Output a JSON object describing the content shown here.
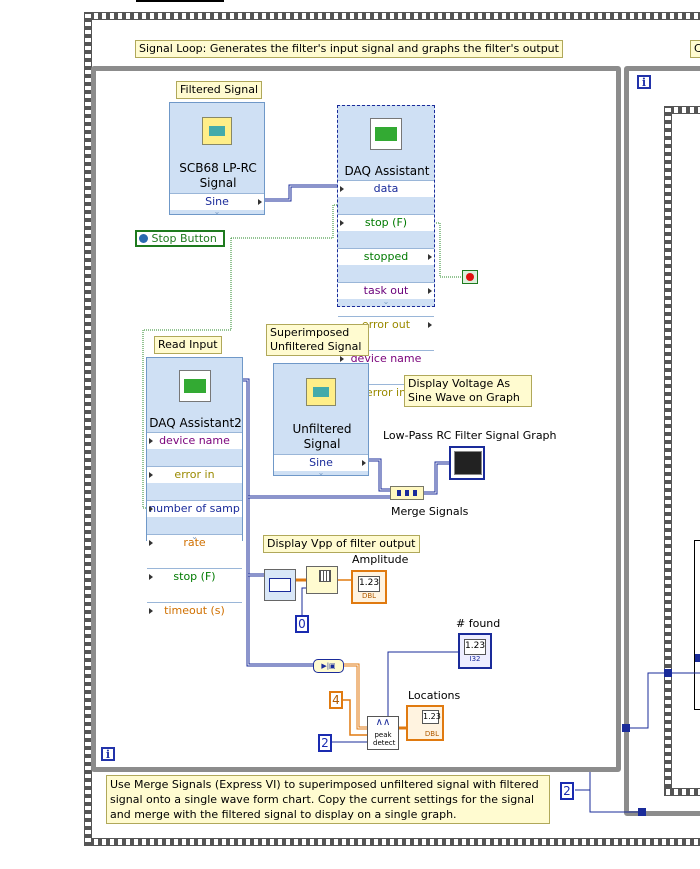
{
  "outer_loop": {
    "note": "Signal Loop: Generates the filter's input signal and graphs the filter's output",
    "right_note_fragment": "C"
  },
  "inner_loop": {
    "info_icon": "i",
    "bottom_note": "Use Merge Signals (Express VI) to superimposed unfiltered signal with filtered signal onto a single wave form chart. Copy the current settings for the signal and merge with the filtered signal to display on a single graph.",
    "count_constant": "2"
  },
  "right_loop": {
    "info_icon": "i"
  },
  "filtered_signal": {
    "label": "Filtered Signal",
    "title": "SCB68 LP-RC Signal",
    "terminal": "Sine"
  },
  "daq_assistant": {
    "title": "DAQ Assistant",
    "terminals": [
      {
        "label": "data",
        "color": "#1a2b9a"
      },
      {
        "label": "stop (F)",
        "color": "#007a00"
      },
      {
        "label": "stopped",
        "color": "#007a00"
      },
      {
        "label": "task out",
        "color": "#6a007a"
      },
      {
        "label": "error out",
        "color": "#9a8a00"
      },
      {
        "label": "device name",
        "color": "#7a007a"
      },
      {
        "label": "error in",
        "color": "#9a8a00"
      }
    ]
  },
  "stop_button": {
    "label": "Stop Button"
  },
  "read_input": {
    "label": "Read Input",
    "title": "DAQ Assistant2",
    "terminals": [
      {
        "label": "device name",
        "color": "#7a007a"
      },
      {
        "label": "error in",
        "color": "#9a8a00"
      },
      {
        "label": "number of samp",
        "color": "#1a2b9a"
      },
      {
        "label": "rate",
        "color": "#d07000"
      },
      {
        "label": "stop (F)",
        "color": "#007a00"
      },
      {
        "label": "timeout (s)",
        "color": "#d07000"
      }
    ]
  },
  "unfiltered_signal": {
    "label": "Superimposed Unfiltered Signal",
    "title": "Unfiltered Signal",
    "terminal": "Sine"
  },
  "display_voltage_note": "Display Voltage As Sine Wave on Graph",
  "graph": {
    "label": "Low-Pass RC Filter Signal Graph"
  },
  "merge_signals": {
    "label": "Merge Signals"
  },
  "vpp_note": "Display Vpp of filter output",
  "amplitude": {
    "label": "Amplitude",
    "display": "1.23",
    "type": "DBL"
  },
  "index_constant": "0",
  "found": {
    "label": "# found",
    "display": "1.23",
    "type": "I32"
  },
  "locations": {
    "label": "Locations",
    "display": "1.23",
    "type": "DBL"
  },
  "threshold_constant": "4",
  "width_constant": "2",
  "peak_detect": {
    "label": "peak detect"
  }
}
